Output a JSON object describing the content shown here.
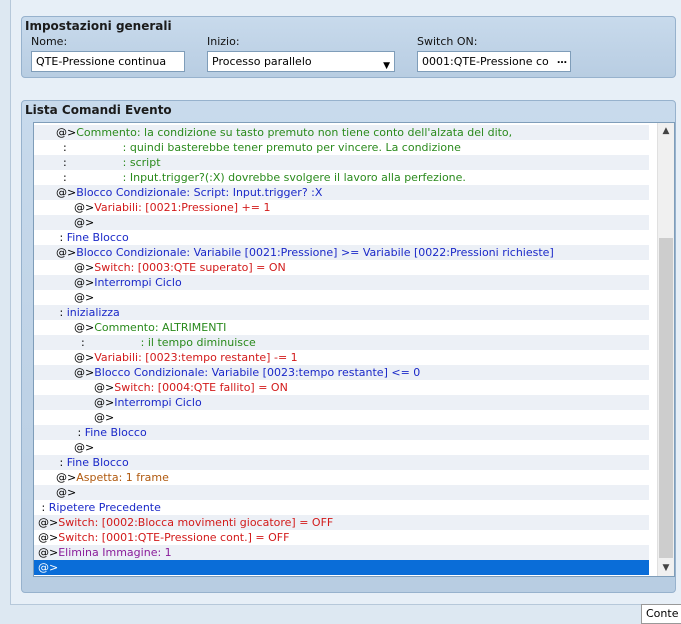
{
  "general": {
    "title": "Impostazioni generali",
    "name_label": "Nome:",
    "name_value": "QTE-Pressione continua",
    "start_label": "Inizio:",
    "start_value": "Processo parallelo",
    "switch_label": "Switch ON:",
    "switch_value": "0001:QTE-Pressione co",
    "switch_button": "…"
  },
  "event_list": {
    "title": "Lista Comandi Evento",
    "rows": [
      {
        "indent": 2,
        "prefix": "@>",
        "text": "Commento: la condizione su tasto premuto non tiene conto dell'alzata del dito,",
        "color": "green"
      },
      {
        "indent": 2,
        "prefix": "  :",
        "text": "                : quindi basterebbe tener premuto per vincere. La condizione",
        "color": "green"
      },
      {
        "indent": 2,
        "prefix": "  :",
        "text": "                : script",
        "color": "green"
      },
      {
        "indent": 2,
        "prefix": "  :",
        "text": "                : Input.trigger?(:X) dovrebbe svolgere il lavoro alla perfezione.",
        "color": "green"
      },
      {
        "indent": 2,
        "prefix": "@>",
        "text": "Blocco Condizionale: Script: Input.trigger? :X",
        "color": "blue"
      },
      {
        "indent": 3,
        "prefix": "@>",
        "text": "Variabili: [0021:Pressione] += 1",
        "color": "red"
      },
      {
        "indent": 3,
        "prefix": "@>",
        "text": "",
        "color": "black"
      },
      {
        "indent": 2,
        "prefix": " :",
        "text": " Fine Blocco",
        "color": "blue"
      },
      {
        "indent": 2,
        "prefix": "@>",
        "text": "Blocco Condizionale: Variabile [0021:Pressione] >= Variabile [0022:Pressioni richieste]",
        "color": "blue"
      },
      {
        "indent": 3,
        "prefix": "@>",
        "text": "Switch: [0003:QTE superato] = ON",
        "color": "red"
      },
      {
        "indent": 3,
        "prefix": "@>",
        "text": "Interrompi Ciclo",
        "color": "blue"
      },
      {
        "indent": 3,
        "prefix": "@>",
        "text": "",
        "color": "black"
      },
      {
        "indent": 2,
        "prefix": " :",
        "text": " inizializza",
        "color": "blue"
      },
      {
        "indent": 3,
        "prefix": "@>",
        "text": "Commento: ALTRIMENTI",
        "color": "green"
      },
      {
        "indent": 3,
        "prefix": "  :",
        "text": "                : il tempo diminuisce",
        "color": "green"
      },
      {
        "indent": 3,
        "prefix": "@>",
        "text": "Variabili: [0023:tempo restante] -= 1",
        "color": "red"
      },
      {
        "indent": 3,
        "prefix": "@>",
        "text": "Blocco Condizionale: Variabile [0023:tempo restante] <= 0",
        "color": "blue"
      },
      {
        "indent": 4,
        "prefix": "@>",
        "text": "Switch: [0004:QTE fallito] = ON",
        "color": "red"
      },
      {
        "indent": 4,
        "prefix": "@>",
        "text": "Interrompi Ciclo",
        "color": "blue"
      },
      {
        "indent": 4,
        "prefix": "@>",
        "text": "",
        "color": "black"
      },
      {
        "indent": 3,
        "prefix": " :",
        "text": " Fine Blocco",
        "color": "blue"
      },
      {
        "indent": 3,
        "prefix": "@>",
        "text": "",
        "color": "black"
      },
      {
        "indent": 2,
        "prefix": " :",
        "text": " Fine Blocco",
        "color": "blue"
      },
      {
        "indent": 2,
        "prefix": "@>",
        "text": "Aspetta: 1 frame",
        "color": "orange"
      },
      {
        "indent": 2,
        "prefix": "@>",
        "text": "",
        "color": "black"
      },
      {
        "indent": 1,
        "prefix": " :",
        "text": " Ripetere Precedente",
        "color": "blue"
      },
      {
        "indent": 1,
        "prefix": "@>",
        "text": "Switch: [0002:Blocca movimenti giocatore] = OFF",
        "color": "red"
      },
      {
        "indent": 1,
        "prefix": "@>",
        "text": "Switch: [0001:QTE-Pressione cont.] = OFF",
        "color": "red"
      },
      {
        "indent": 1,
        "prefix": "@>",
        "text": "Elimina Immagine: 1",
        "color": "purple"
      },
      {
        "indent": 1,
        "prefix": "@>",
        "text": "",
        "color": "black",
        "selected": true
      }
    ]
  },
  "tooltip": "Conte",
  "icons": {
    "scroll_up": "scroll-up-icon",
    "scroll_down": "scroll-down-icon",
    "dropdown": "chevron-down-icon"
  },
  "colors": {
    "green": "#2a8a1c",
    "blue": "#1a28c8",
    "red": "#d21a1a",
    "orange": "#b0590e",
    "purple": "#8a1c9a",
    "selection": "#0a6dd8"
  }
}
